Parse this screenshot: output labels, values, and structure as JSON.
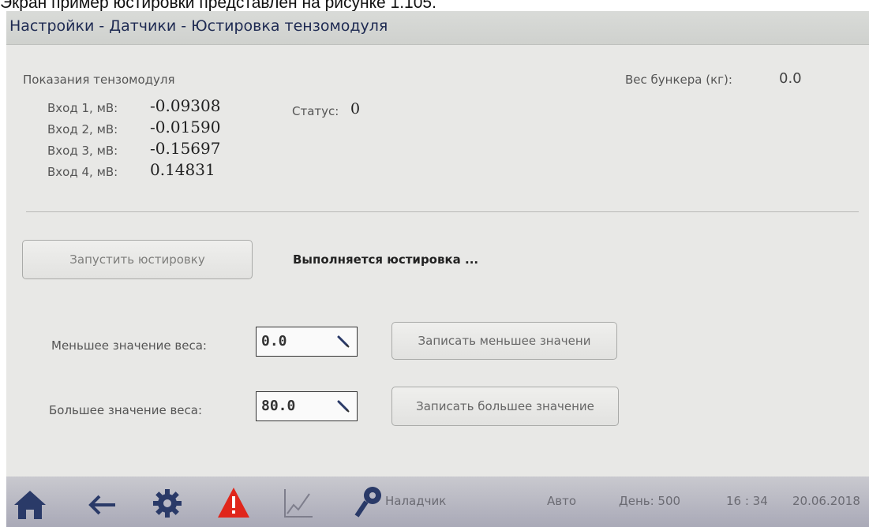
{
  "caption": "Экран пример юстировки представлен на рисунке 1.105.",
  "title": "Настройки - Датчики - Юстировка тензомодуля",
  "readings": {
    "section_label": "Показания тензомодуля",
    "inputs": [
      {
        "label": "Вход 1, мВ:",
        "value": "-0.09308"
      },
      {
        "label": "Вход 2, мВ:",
        "value": "-0.01590"
      },
      {
        "label": "Вход 3, мВ:",
        "value": "-0.15697"
      },
      {
        "label": "Вход 4, мВ:",
        "value": "0.14831"
      }
    ],
    "status_label": "Статус:",
    "status_value": "0",
    "bunker_label": "Вес бункера (кг):",
    "bunker_value": "0.0"
  },
  "calibration": {
    "start_button": "Запустить юстировку",
    "status_text": "Выполняется юстировка ...",
    "lower_label": "Меньшее значение веса:",
    "lower_value": "0.0",
    "lower_button": "Записать меньшее значени",
    "upper_label": "Большее значение веса:",
    "upper_value": "80.0",
    "upper_button": "Записать большее значение"
  },
  "bottombar": {
    "icons": [
      "home-icon",
      "back-arrow-icon",
      "gear-icon",
      "warning-icon",
      "chart-icon",
      "key-icon"
    ],
    "user": "Наладчик",
    "mode": "Авто",
    "day": "День: 500",
    "time": "16 : 34",
    "date": "20.06.2018",
    "colors": {
      "warning": "#e0261b",
      "icons": "#2a3a68"
    }
  }
}
